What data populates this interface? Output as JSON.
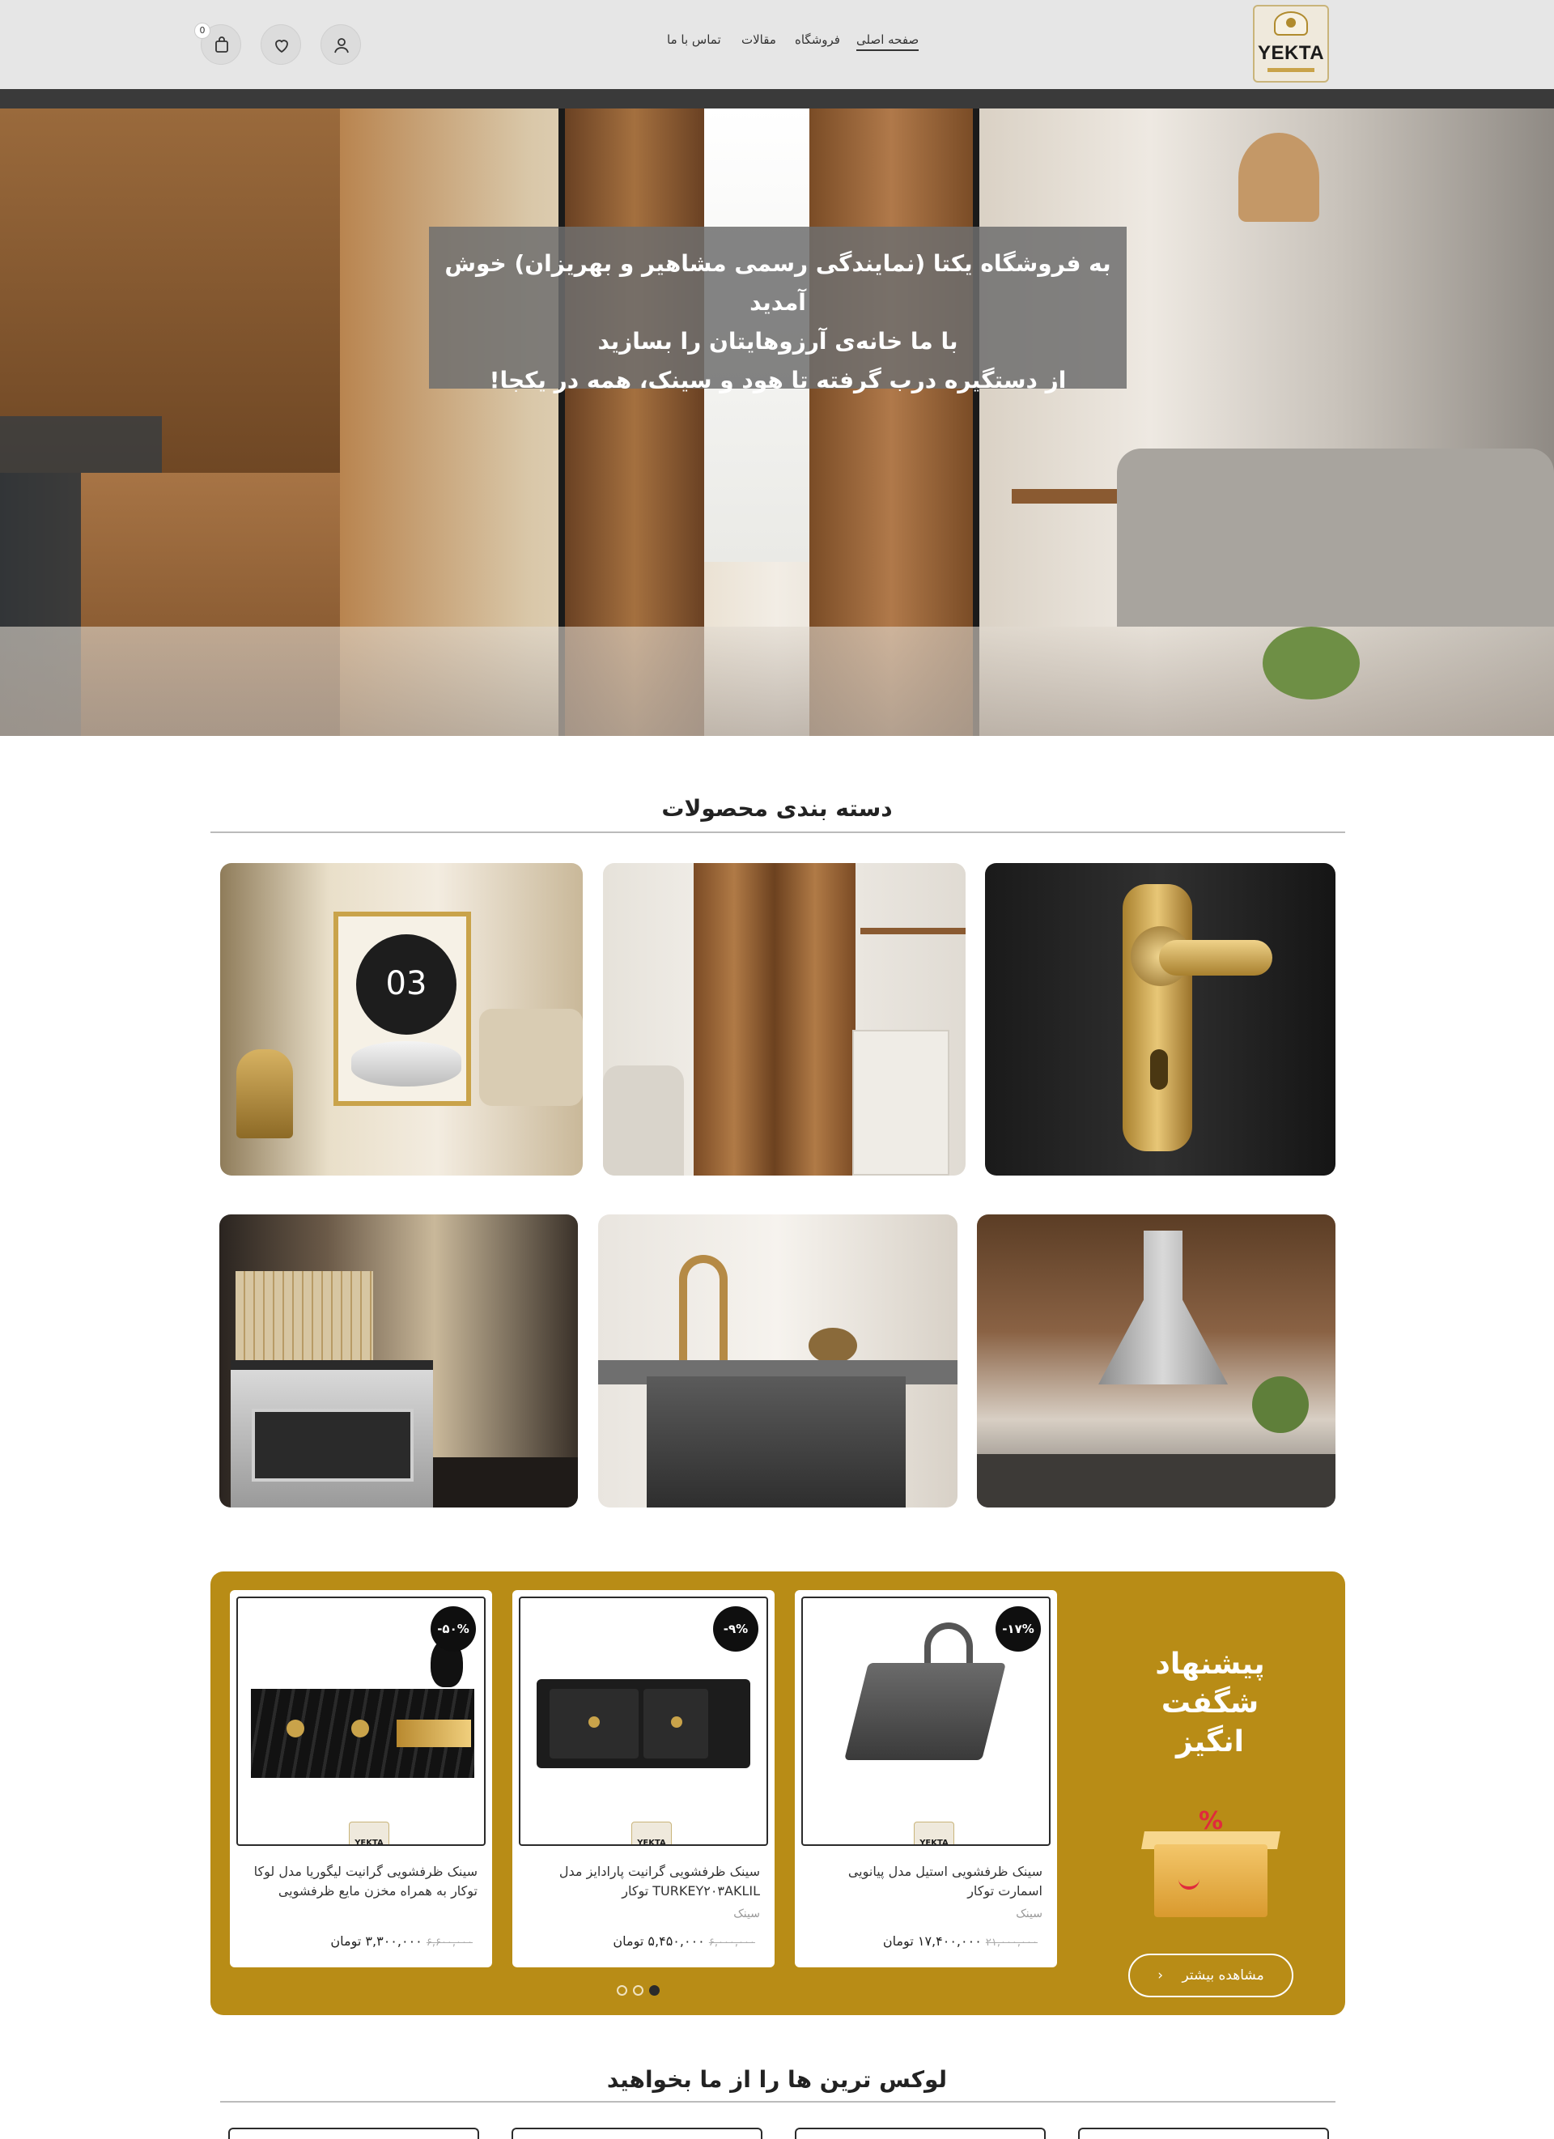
{
  "header": {
    "logo_text": "YEKTA",
    "nav": {
      "home": "صفحه اصلی",
      "shop": "فروشگاه",
      "articles": "مقالات",
      "contact": "تماس با ما"
    },
    "icons": [
      "user-icon",
      "heart-icon",
      "cart-icon"
    ],
    "cart_count": "0"
  },
  "hero": {
    "line1": "به فروشگاه یکتا (نمایندگی رسمی مشاهیر و بهریزان) خوش آمدید",
    "line2": "با ما خانه‌ی آرزوهایتان را بسازید",
    "line3": "از دستگیره درب گرفته تا هود و سینک، همه در یکجا!"
  },
  "categories": {
    "title": "دسته بندی محصولات",
    "tile1_digits": "03"
  },
  "offers": {
    "title_line1": "پیشنهاد",
    "title_line2": "شگفت",
    "title_line3": "انگیز",
    "gift_symbol": "%",
    "more_label": "مشاهده بیشتر",
    "more_arrow": "‹",
    "brand_label": "YEKTA",
    "accent_color": "#b88c16",
    "products": [
      {
        "badge": "-۱۷%",
        "name": "سینک ظرفشویی استیل مدل پیانویی اسمارت توکار",
        "category": "سینک",
        "old_price": "۲۱,۰۰۰,۰۰۰",
        "price": "۱۷,۴۰۰,۰۰۰ تومان"
      },
      {
        "badge": "-۹%",
        "name": "سینک ظرفشویی گرانیت پارادایز مدل TURKEY۲۰۳AKLIL توکار",
        "category": "سینک",
        "old_price": "۶,۰۰۰,۰۰۰",
        "price": "۵,۴۵۰,۰۰۰ تومان"
      },
      {
        "badge": "-۵۰%",
        "name": "سینک ظرفشویی گرانیت لیگوریا مدل لوکا توکار به همراه مخزن مایع ظرفشویی",
        "category": "",
        "old_price": "۶,۶۰۰,۰۰۰",
        "price": "۳,۳۰۰,۰۰۰ تومان"
      }
    ]
  },
  "luxury": {
    "title": "لوکس ترین ها را از ما بخواهید"
  }
}
